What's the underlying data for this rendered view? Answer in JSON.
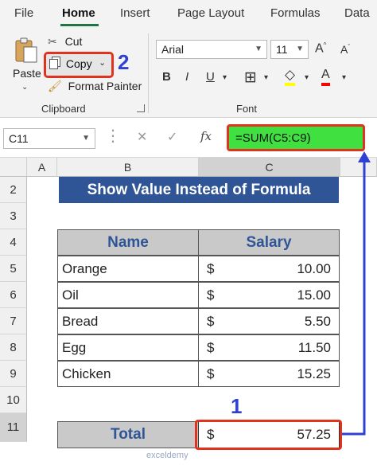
{
  "tabs": [
    "File",
    "Home",
    "Insert",
    "Page Layout",
    "Formulas",
    "Data"
  ],
  "clipboard": {
    "paste": "Paste",
    "cut": "Cut",
    "copy": "Copy",
    "format_painter": "Format Painter",
    "group_label": "Clipboard"
  },
  "font": {
    "name": "Arial",
    "size": "11",
    "group_label": "Font",
    "buttons": [
      "B",
      "I",
      "U"
    ]
  },
  "callouts": {
    "one": "1",
    "two": "2"
  },
  "formula_bar": {
    "name_box": "C11",
    "cancel": "✕",
    "enter": "✓",
    "fx": "fx",
    "formula": "=SUM(C5:C9)"
  },
  "grid": {
    "columns": [
      "A",
      "B",
      "C"
    ],
    "rows": [
      "2",
      "3",
      "4",
      "5",
      "6",
      "7",
      "8",
      "9",
      "10",
      "11"
    ]
  },
  "sheet": {
    "title": "Show Value Instead of Formula",
    "headers": {
      "name": "Name",
      "salary": "Salary"
    },
    "currency": "$",
    "items": [
      {
        "name": "Orange",
        "amount": "10.00"
      },
      {
        "name": "Oil",
        "amount": "15.00"
      },
      {
        "name": "Bread",
        "amount": "5.50"
      },
      {
        "name": "Egg",
        "amount": "11.50"
      },
      {
        "name": "Chicken",
        "amount": "15.25"
      }
    ],
    "total_label": "Total",
    "total_amount": "57.25"
  },
  "watermark": "exceldemy",
  "colors": {
    "accent_green": "#217346",
    "title_blue": "#2f5597",
    "highlight_red": "#e0331f",
    "callout_blue": "#2f40d4",
    "formula_green": "#3fe03f"
  }
}
